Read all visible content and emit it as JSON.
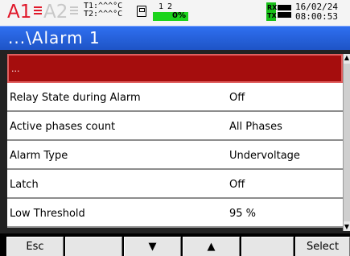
{
  "status": {
    "alarm1": "A1",
    "alarm2": "A2",
    "temp1": "T1:^^^°C",
    "temp2": "T2:^^^°C",
    "channels": [
      "1",
      "2"
    ],
    "progress_text": "0%",
    "progress_value": 0,
    "rx": "RX",
    "tx": "TX",
    "date": "16/02/24",
    "time": "08:00:53",
    "colors": {
      "alarm_active": "#e0182a",
      "alarm_inactive": "#c8c8c8",
      "progress": "#1cd41c",
      "rxtx": "#18c018"
    },
    "icons": [
      "sd-card-icon",
      "network-icon"
    ]
  },
  "title": "...\\Alarm  1",
  "list": {
    "header": "...",
    "rows": [
      {
        "label": "Relay State during Alarm",
        "value": "Off"
      },
      {
        "label": "Active phases count",
        "value": "All Phases"
      },
      {
        "label": "Alarm Type",
        "value": "Undervoltage"
      },
      {
        "label": "Latch",
        "value": "Off"
      },
      {
        "label": "Low Threshold",
        "value": "95 %"
      }
    ]
  },
  "softkeys": {
    "k1": "Esc",
    "k2": "",
    "k3": "▼",
    "k4": "▲",
    "k5": "",
    "k6": "Select"
  }
}
